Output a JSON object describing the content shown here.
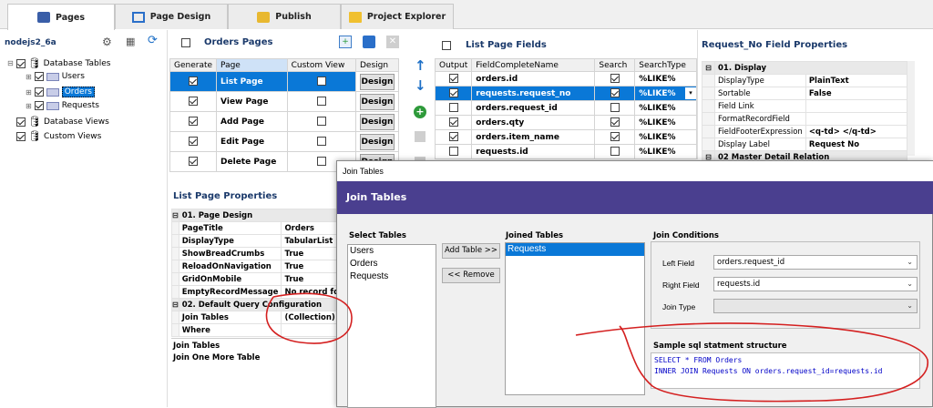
{
  "tabs": [
    {
      "label": "Pages"
    },
    {
      "label": "Page Design"
    },
    {
      "label": "Publish"
    },
    {
      "label": "Project Explorer"
    }
  ],
  "tree": {
    "root": "nodejs2_6a",
    "database_tables": "Database Tables",
    "tables": [
      "Users",
      "Orders",
      "Requests"
    ],
    "database_views": "Database Views",
    "custom_views": "Custom Views"
  },
  "orders_pages": {
    "title": "Orders Pages",
    "headers": [
      "Generate",
      "Page",
      "Custom View",
      "Design"
    ],
    "design_label": "Design",
    "rows": [
      {
        "page": "List Page",
        "custom": false
      },
      {
        "page": "View Page",
        "custom": false
      },
      {
        "page": "Add Page",
        "custom": false
      },
      {
        "page": "Edit Page",
        "custom": false
      },
      {
        "page": "Delete Page",
        "custom": false
      }
    ]
  },
  "list_page_properties": {
    "title": "List Page Properties",
    "cat1": "01. Page Design",
    "props1": [
      {
        "k": "PageTitle",
        "v": "Orders"
      },
      {
        "k": "DisplayType",
        "v": "TabularList"
      },
      {
        "k": "ShowBreadCrumbs",
        "v": "True"
      },
      {
        "k": "ReloadOnNavigation",
        "v": "True"
      },
      {
        "k": "GridOnMobile",
        "v": "True"
      },
      {
        "k": "EmptyRecordMessage",
        "v": "No record fou"
      }
    ],
    "cat2": "02. Default Query Configuration",
    "props2": [
      {
        "k": "Join Tables",
        "v": "(Collection)"
      },
      {
        "k": "Where",
        "v": ""
      }
    ],
    "desc_title": "Join Tables",
    "desc_text": "Join One More Table"
  },
  "list_page_fields": {
    "title": "List Page Fields",
    "headers": [
      "Output",
      "FieldCompleteName",
      "Search",
      "SearchType"
    ],
    "rows": [
      {
        "out": true,
        "name": "orders.id",
        "search": true,
        "type": "%LIKE%"
      },
      {
        "out": true,
        "name": "requests.request_no",
        "search": true,
        "type": "%LIKE%"
      },
      {
        "out": false,
        "name": "orders.request_id",
        "search": false,
        "type": "%LIKE%"
      },
      {
        "out": true,
        "name": "orders.qty",
        "search": true,
        "type": "%LIKE%"
      },
      {
        "out": true,
        "name": "orders.item_name",
        "search": true,
        "type": "%LIKE%"
      },
      {
        "out": false,
        "name": "requests.id",
        "search": false,
        "type": "%LIKE%"
      }
    ]
  },
  "field_properties": {
    "title": "Request_No Field Properties",
    "cat1": "01. Display",
    "props": [
      {
        "k": "DisplayType",
        "v": "PlainText"
      },
      {
        "k": "Sortable",
        "v": "False"
      },
      {
        "k": "Field Link",
        "v": ""
      },
      {
        "k": "FormatRecordField",
        "v": ""
      },
      {
        "k": "FieldFooterExpression",
        "v": "<q-td> </q-td>"
      },
      {
        "k": "Display Label",
        "v": "Request No"
      }
    ],
    "cat2": "02 Master Detail Relation"
  },
  "join_dialog": {
    "window_title": "Join Tables",
    "header": "Join Tables",
    "select_tables_label": "Select Tables",
    "select_tables": [
      "Users",
      "Orders",
      "Requests"
    ],
    "add_table": "Add Table >>",
    "remove": "<< Remove",
    "joined_tables_label": "Joined Tables",
    "joined_tables": [
      "Requests"
    ],
    "join_conditions_label": "Join Conditions",
    "left_field_label": "Left Field",
    "left_field": "orders.request_id",
    "right_field_label": "Right Field",
    "right_field": "requests.id",
    "join_type_label": "Join Type",
    "join_type": "",
    "sql_label": "Sample sql statment structure",
    "sql_line1": "SELECT * FROM Orders",
    "sql_line2": "INNER JOIN Requests ON orders.request_id=requests.id"
  },
  "colors": {
    "accent": "#0a78d7",
    "dialog_header": "#4a3f8f",
    "annotation": "#d42020"
  }
}
